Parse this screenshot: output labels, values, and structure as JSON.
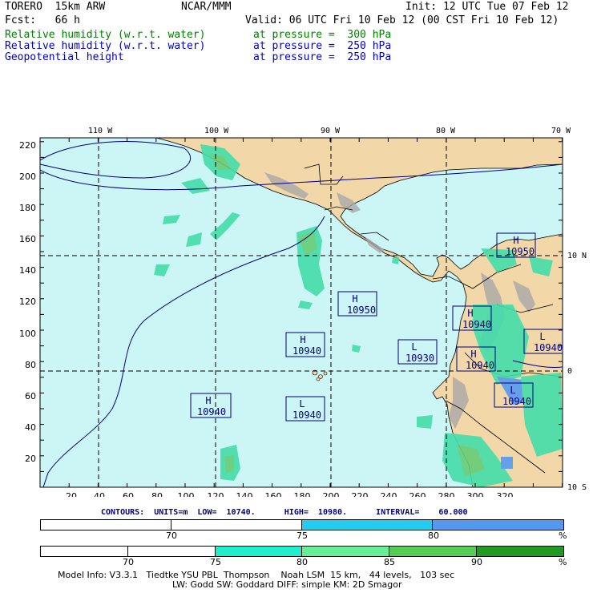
{
  "header": {
    "model": "TORERO  15km ARW",
    "center": "NCAR/MMM",
    "init": "Init: 12 UTC Tue 07 Feb 12",
    "fcst": "Fcst:   66 h",
    "valid": "Valid: 06 UTC Fri 10 Feb 12 (00 CST Fri 10 Feb 12)",
    "fields": [
      {
        "name": "Relative humidity (w.r.t. water)",
        "level": "at pressure =  300 hPa",
        "color": "#008000"
      },
      {
        "name": "Relative humidity (w.r.t. water)",
        "level": "at pressure =  250 hPa",
        "color": "#0000c8"
      },
      {
        "name": "Geopotential height",
        "level": "at pressure =  250 hPa",
        "color": "#0000c8"
      }
    ]
  },
  "map": {
    "lon_labels": [
      "110 W",
      "100 W",
      "90 W",
      "80 W",
      "70 W"
    ],
    "lat_labels": [
      "10 N",
      "0",
      "10 S"
    ],
    "y_ticks": [
      "220",
      "200",
      "180",
      "160",
      "140",
      "120",
      "100",
      "80",
      "60",
      "40",
      "20"
    ],
    "x_ticks": [
      "20",
      "40",
      "60",
      "80",
      "100",
      "120",
      "140",
      "160",
      "180",
      "200",
      "220",
      "240",
      "260",
      "280",
      "300",
      "320"
    ],
    "highs_lows": [
      {
        "type": "H",
        "value": "10950"
      },
      {
        "type": "H",
        "value": "10950"
      },
      {
        "type": "H",
        "value": "10940"
      },
      {
        "type": "L",
        "value": "10930"
      },
      {
        "type": "H",
        "value": "10940"
      },
      {
        "type": "H",
        "value": "10940"
      },
      {
        "type": "L",
        "value": "10940"
      },
      {
        "type": "L",
        "value": "10940"
      },
      {
        "type": "H",
        "value": "10940"
      },
      {
        "type": "L",
        "value": "10940"
      }
    ],
    "colors": {
      "ocean": "#ccf5f5",
      "land": "#f2d7a8",
      "mountain": "#a0a0a0",
      "contour": "#000080"
    }
  },
  "contours_line": "CONTOURS:  UNITS=m  LOW=  10740.      HIGH=  10980.      INTERVAL=    60.000",
  "colorbar_250": {
    "labels": [
      "70",
      "75",
      "80",
      "%"
    ],
    "colors": [
      "#ffffff",
      "#ffffff",
      "#22ccee",
      "#5599ee"
    ]
  },
  "colorbar_300": {
    "labels": [
      "70",
      "75",
      "80",
      "85",
      "90",
      "%"
    ],
    "colors": [
      "#ffffff",
      "#ffffff",
      "#ffffff",
      "#22eecc",
      "#66ee99",
      "#55cc55",
      "#229922"
    ]
  },
  "model_info": [
    "Model Info: V3.3.1   Tiedtke YSU PBL  Thompson    Noah LSM  15 km,   44 levels,   103 sec",
    "LW: Godd SW: Goddard DIFF: simple KM: 2D Smagor"
  ]
}
